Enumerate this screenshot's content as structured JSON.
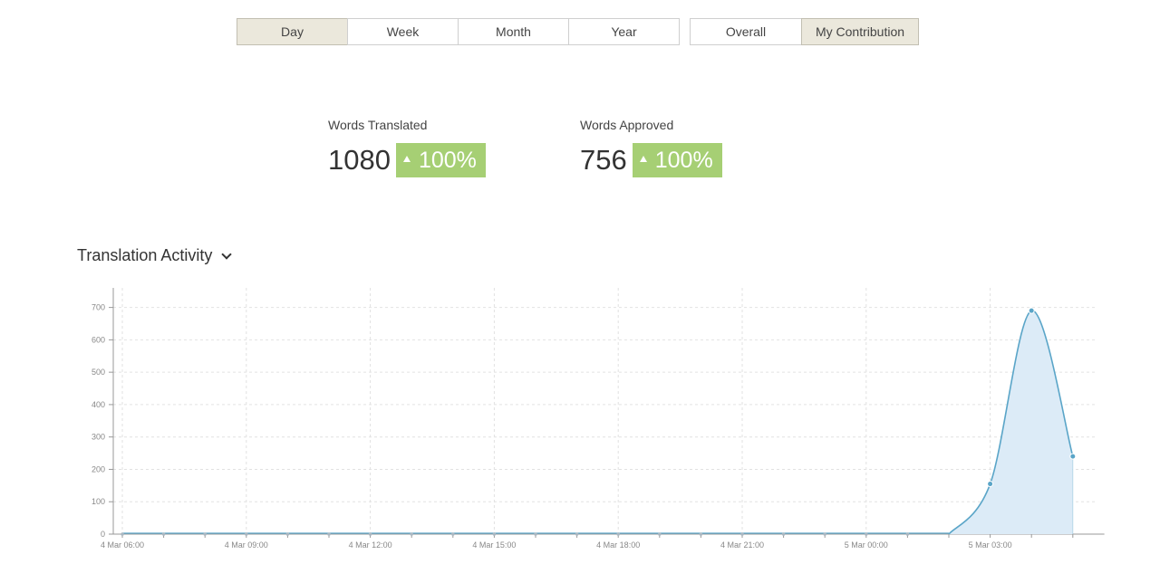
{
  "range_tabs": [
    {
      "label": "Day",
      "active": true
    },
    {
      "label": "Week",
      "active": false
    },
    {
      "label": "Month",
      "active": false
    },
    {
      "label": "Year",
      "active": false
    }
  ],
  "scope_tabs": [
    {
      "label": "Overall",
      "active": false
    },
    {
      "label": "My Contribution",
      "active": true
    }
  ],
  "stats": [
    {
      "label": "Words Translated",
      "value": "1080",
      "change": "100%"
    },
    {
      "label": "Words Approved",
      "value": "756",
      "change": "100%"
    }
  ],
  "section": {
    "title": "Translation Activity"
  },
  "colors": {
    "accent_green": "#a6cf74",
    "line": "#5aa5c8",
    "area": "#dcebf7"
  },
  "chart_data": {
    "type": "area",
    "y_ticks": [
      0,
      100,
      200,
      300,
      400,
      500,
      600,
      700
    ],
    "ylim": [
      0,
      750
    ],
    "x_labels": [
      "4 Mar 06:00",
      "4 Mar 09:00",
      "4 Mar 12:00",
      "4 Mar 15:00",
      "4 Mar 18:00",
      "4 Mar 21:00",
      "5 Mar 00:00",
      "5 Mar 03:00"
    ],
    "x_label_hours": [
      0,
      3,
      6,
      9,
      12,
      15,
      18,
      21
    ],
    "xlim_hours": [
      0,
      23.5
    ],
    "points": [
      {
        "x": 20,
        "y": 0
      },
      {
        "x": 21,
        "y": 155
      },
      {
        "x": 22,
        "y": 690
      },
      {
        "x": 23,
        "y": 240
      }
    ],
    "grid": true
  }
}
